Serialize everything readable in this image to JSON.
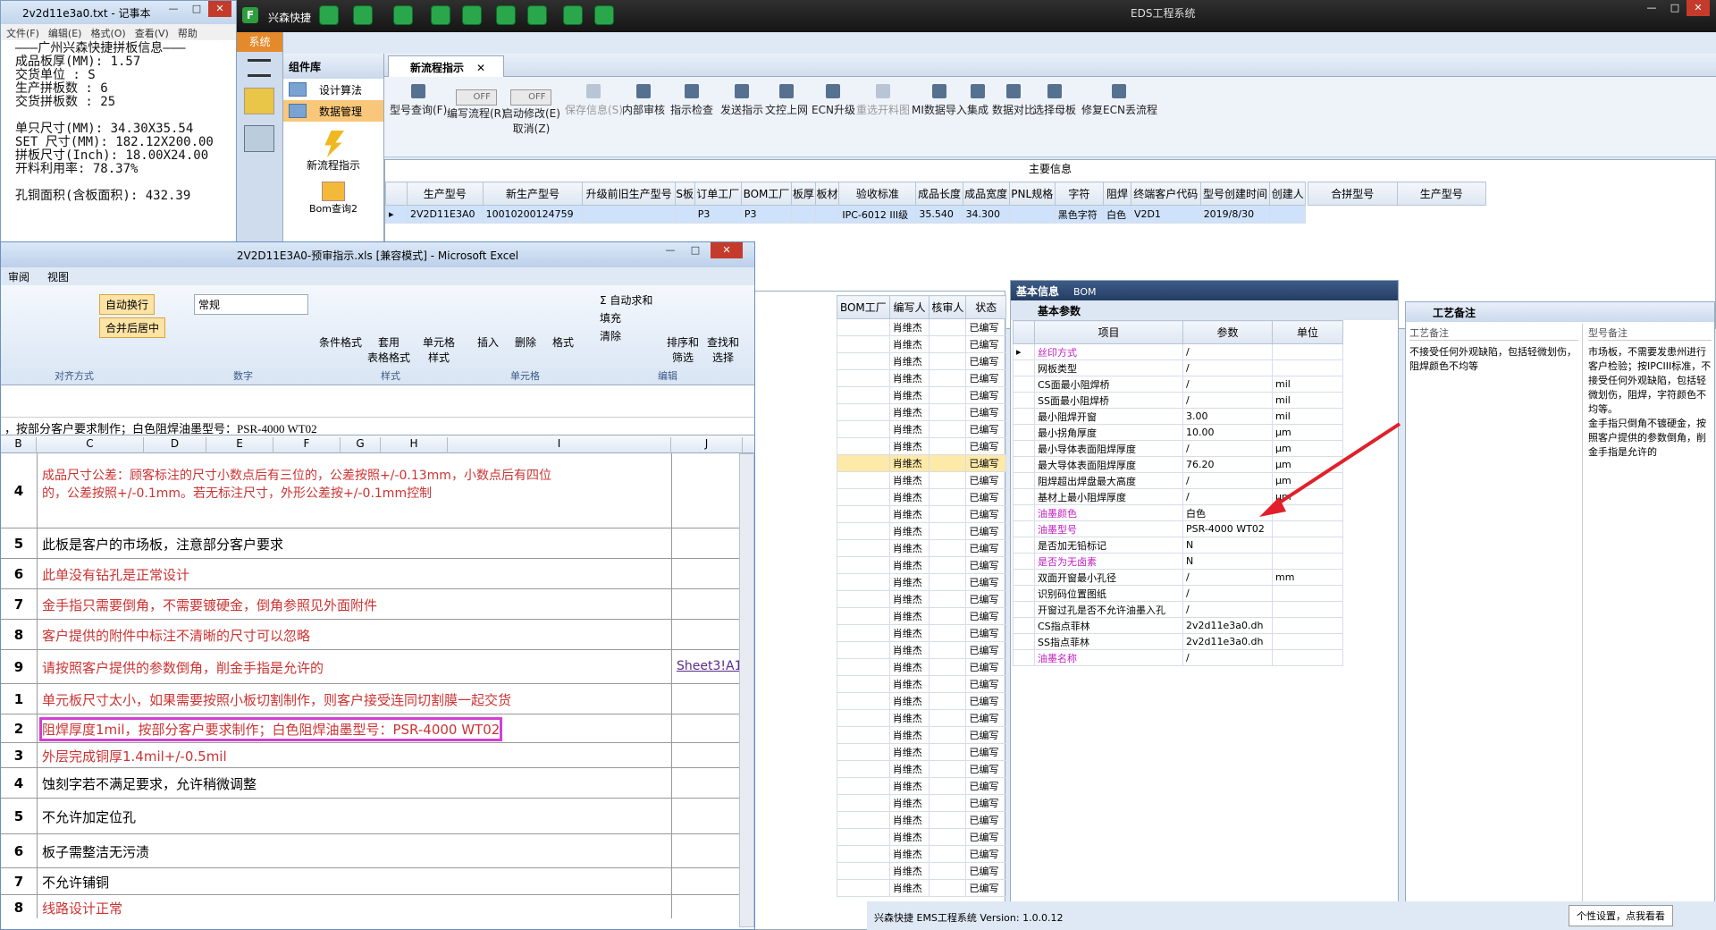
{
  "notepad": {
    "title": "2v2d11e3a0.txt - 记事本",
    "menu": [
      "文件(F)",
      "编辑(E)",
      "格式(O)",
      "查看(V)",
      "帮助"
    ],
    "lines": [
      "———广州兴森快捷拼板信息———",
      "成品板厚(MM): 1.57",
      "交货单位 : S",
      "生产拼板数 : 6",
      "交货拼板数 : 25",
      "",
      "单只尺寸(MM): 34.30X35.54",
      "SET 尺寸(MM): 182.12X200.00",
      "拼板尺寸(Inch): 18.00X24.00",
      "开料利用率: 78.37%",
      "",
      "孔铜面积(含板面积): 432.39"
    ]
  },
  "eds": {
    "title": "EDS工程系统",
    "brand": "兴森快捷",
    "system_tab": "系统",
    "status": "兴森快捷 EMS工程系统 Version: 1.0.0.12",
    "tooltip": "个性设置，点我看看",
    "library": {
      "title": "组件库",
      "items": [
        "设计算法",
        "数据管理"
      ],
      "big": [
        "新流程指示",
        "Bom查询2"
      ]
    },
    "tab": "新流程指示",
    "tools": [
      {
        "label": "型号查询(F)",
        "dis": false
      },
      {
        "label": "编写流程(R)",
        "dis": false
      },
      {
        "label": "启动修改(E)\n取消(Z)",
        "dis": false
      },
      {
        "label": "保存信息(S)",
        "dis": true
      },
      {
        "label": "内部审核",
        "dis": false
      },
      {
        "label": "指示检查",
        "dis": false
      },
      {
        "label": "发送指示",
        "dis": false
      },
      {
        "label": "文控上网",
        "dis": false
      },
      {
        "label": "ECN升级",
        "dis": false
      },
      {
        "label": "重选开料图",
        "dis": true
      },
      {
        "label": "MI数据导入",
        "dis": false
      },
      {
        "label": "集成",
        "dis": false
      },
      {
        "label": "数据对比",
        "dis": false
      },
      {
        "label": "选择母板",
        "dis": false
      },
      {
        "label": "修复ECN丢流程",
        "dis": false
      }
    ],
    "toggle_off": "OFF",
    "main_info": "主要信息",
    "main_cols": [
      "生产型号",
      "新生产型号",
      "升级前旧生产型号",
      "S板",
      "订单工厂",
      "BOM工厂",
      "板厚",
      "板材",
      "验收标准",
      "成品长度",
      "成品宽度",
      "PNL规格",
      "字符",
      "阻焊",
      "终端客户代码",
      "型号创建时间",
      "创建人"
    ],
    "main_row": [
      "2V2D11E3A0",
      "10010200124759",
      "",
      "",
      "P3",
      "P3",
      "",
      "",
      "IPC-6012 III级",
      "35.540",
      "34.300",
      "",
      "黑色字符",
      "白色",
      "V2D1",
      "2019/8/30",
      ""
    ],
    "side_cols": [
      "合拼型号",
      "生产型号"
    ],
    "basic_tabs": [
      "基本信息",
      "BOM"
    ],
    "basic_sub": "基本参数",
    "param_cols": [
      "项目",
      "参数",
      "单位"
    ],
    "params": [
      [
        "丝印方式",
        "/",
        "",
        true
      ],
      [
        "网板类型",
        "/",
        "",
        false
      ],
      [
        "CS面最小阻焊桥",
        "/",
        "mil",
        false
      ],
      [
        "SS面最小阻焊桥",
        "/",
        "mil",
        false
      ],
      [
        "最小阻焊开窗",
        "3.00",
        "mil",
        false
      ],
      [
        "最小拐角厚度",
        "10.00",
        "μm",
        false
      ],
      [
        "最小导体表面阻焊厚度",
        "/",
        "μm",
        false
      ],
      [
        "最大导体表面阻焊厚度",
        "76.20",
        "μm",
        false
      ],
      [
        "阻焊超出焊盘最大高度",
        "/",
        "μm",
        false
      ],
      [
        "基材上最小阻焊厚度",
        "/",
        "μm",
        false
      ],
      [
        "油墨颜色",
        "白色",
        "",
        true
      ],
      [
        "油墨型号",
        "PSR-4000 WT02",
        "",
        true
      ],
      [
        "是否加无铅标记",
        "N",
        "",
        false
      ],
      [
        "是否为无卤素",
        "N",
        "",
        true
      ],
      [
        "双面开窗最小孔径",
        "/",
        "mm",
        false
      ],
      [
        "识别码位置图纸",
        "/",
        "",
        false
      ],
      [
        "开窗过孔是否不允许油墨入孔",
        "/",
        "",
        false
      ],
      [
        "CS指点菲林",
        "2v2d11e3a0.dh",
        "",
        false
      ],
      [
        "SS指点菲林",
        "2v2d11e3a0.dh",
        "",
        false
      ],
      [
        "油墨名称",
        "/",
        "",
        true
      ]
    ],
    "remark_title": "工艺备注",
    "remark_cols": [
      "工艺备注",
      "型号备注"
    ],
    "remark1": "不接受任何外观缺陷，包括轻微划伤，阻焊颜色不均等",
    "remark2": "市场板，不需要发患州进行客户检验；按IPCIII标准，不接受任何外观缺陷，包括轻微划伤，阻焊，字符颜色不均等。\n金手指只倒角不镀硬金，按照客户提供的参数倒角，削金手指是允许的",
    "list_cols": [
      "BOM工厂",
      "编写人",
      "核审人",
      "状态"
    ],
    "list_writer": "肖维杰",
    "list_status": "已编写"
  },
  "excel": {
    "title": "2V2D11E3A0-预审指示.xls [兼容模式] - Microsoft Excel",
    "menu": [
      "审阅",
      "视图"
    ],
    "ribbon": {
      "wrap": "自动换行",
      "merge": "合并后居中",
      "format": "常规",
      "cond": "条件格式",
      "table": "套用\n表格格式",
      "cell": "单元格\n样式",
      "insert": "插入",
      "delete": "删除",
      "fmt": "格式",
      "sum": "自动求和",
      "fill": "填充",
      "clear": "清除",
      "sort": "排序和\n筛选",
      "find": "查找和\n选择",
      "groups": [
        "对齐方式",
        "数字",
        "样式",
        "单元格",
        "编辑"
      ]
    },
    "formula": "，按部分客户要求制作；白色阻焊油墨型号：PSR-4000 WT02",
    "cols": [
      "B",
      "C",
      "D",
      "E",
      "F",
      "G",
      "H",
      "I",
      "J"
    ],
    "rows": [
      {
        "n": "4",
        "t": "成品尺寸公差：顾客标注的尺寸小数点后有三位的，公差按照+/-0.13mm，小数点后有四位\n的，公差按照+/-0.1mm。若无标注尺寸，外形公差按+/-0.1mm控制",
        "red": true,
        "h": 84
      },
      {
        "n": "5",
        "t": "此板是客户的市场板，注意部分客户要求",
        "red": false,
        "h": 34
      },
      {
        "n": "6",
        "t": "此单没有钻孔是正常设计",
        "red": true,
        "h": 34
      },
      {
        "n": "7",
        "t": "金手指只需要倒角，不需要镀硬金，倒角参照见外面附件",
        "red": true,
        "h": 34
      },
      {
        "n": "8",
        "t": "客户提供的附件中标注不清晰的尺寸可以忽略",
        "red": true,
        "h": 34
      },
      {
        "n": "9",
        "t": "请按照客户提供的参数倒角，削金手指是允许的",
        "red": true,
        "h": 38,
        "link": "Sheet3!A1"
      },
      {
        "n": "1",
        "t": "单元板尺寸太小，如果需要按照小板切割制作，则客户接受连同切割膜一起交货",
        "red": true,
        "h": 34
      },
      {
        "n": "2",
        "t": "阻焊厚度1mil，按部分客户要求制作；白色阻焊油墨型号：PSR-4000 WT02",
        "red": true,
        "h": 32
      },
      {
        "n": "3",
        "t": "外层完成铜厚1.4mil+/-0.5mil",
        "red": true,
        "h": 28
      },
      {
        "n": "4",
        "t": "蚀刻字若不满足要求，允许稍微调整",
        "red": false,
        "h": 34
      },
      {
        "n": "5",
        "t": "不允许加定位孔",
        "red": false,
        "h": 40
      },
      {
        "n": "6",
        "t": "板子需整洁无污渍",
        "red": false,
        "h": 38
      },
      {
        "n": "7",
        "t": "不允许铺铜",
        "red": false,
        "h": 30
      },
      {
        "n": "8",
        "t": "线路设计正常",
        "red": true,
        "h": 28
      }
    ]
  }
}
